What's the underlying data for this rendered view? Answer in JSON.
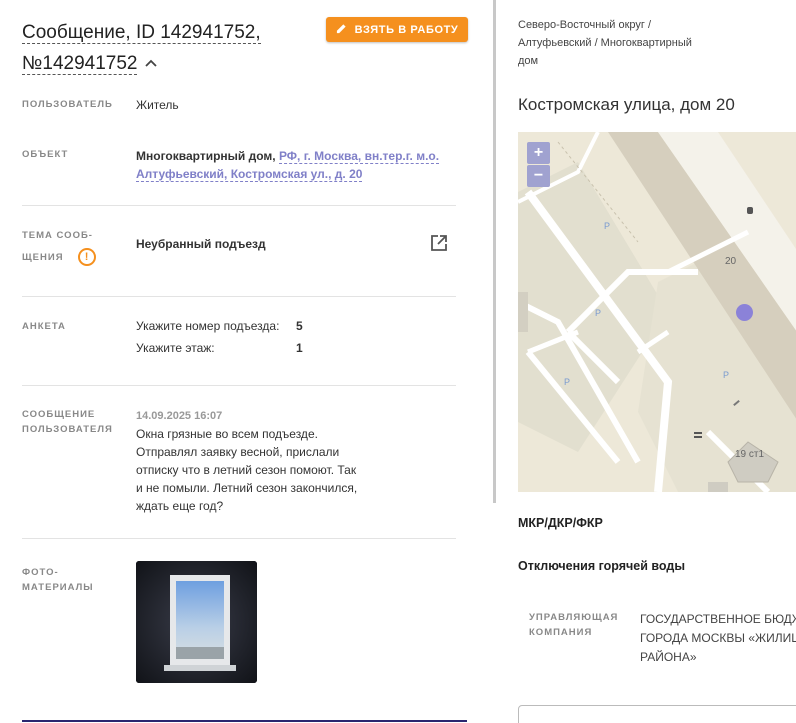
{
  "message": {
    "title_line1": "Сообщение, ID 142941752,",
    "title_line2": "№142941752",
    "take_button": "ВЗЯТЬ В РАБОТУ"
  },
  "fields": {
    "user_label": "ПОЛЬЗОВАТЕЛЬ",
    "user_value": "Житель",
    "object_label": "ОБЪЕКТ",
    "object_type": "Многоквартирный дом,",
    "object_address": "РФ, г. Москва, вн.тер.г. м.о. Алтуфьевский, Костромская ул., д. 20",
    "topic_label_1": "ТЕМА СООБ-",
    "topic_label_2": "ЩЕНИЯ",
    "topic_value": "Неубранный подъезд",
    "warn_glyph": "!",
    "anketa_label": "АНКЕТА",
    "anketa": [
      {
        "q": "Укажите номер подъезда:",
        "a": "5"
      },
      {
        "q": "Укажите этаж:",
        "a": "1"
      }
    ],
    "usermsg_label_1": "СООБЩЕНИЕ",
    "usermsg_label_2": "ПОЛЬЗОВАТЕЛЯ",
    "usermsg_date": "14.09.2025 16:07",
    "usermsg_lines": [
      "Окна грязные во всем подъезде.",
      "Отправлял заявку весной, прислали",
      "отписку что в летний сезон помоют. Так",
      "и не помыли. Летний сезон закончился,",
      "ждать еще год?"
    ],
    "photo_label_1": "ФОТО-",
    "photo_label_2": "МАТЕРИАЛЫ"
  },
  "right": {
    "crumb_lines": [
      "Северо-Восточный округ /",
      "Алтуфьевский / Многоквартирный",
      "дом"
    ],
    "address": "Костромская улица, дом 20",
    "map": {
      "zoom_in": "+",
      "zoom_out": "−",
      "label_house": "20",
      "label_building": "19 ст1",
      "parking": "P",
      "marker_color": "#8b82d8"
    },
    "section_mkr": "МКР/ДКР/ФКР",
    "section_hotwater": "Отключения горячей воды",
    "mc_label_1": "УПРАВЛЯЮЩАЯ",
    "mc_label_2": "КОМПАНИЯ",
    "mc_value_lines": [
      "ГОСУДАРСТВЕННОЕ БЮДЖ",
      "ГОРОДА МОСКВЫ «ЖИЛИШ",
      "РАЙОНА»"
    ]
  },
  "colors": {
    "accent": "#f5901e",
    "link": "#8080c8",
    "zoom": "#a0a2d0"
  }
}
